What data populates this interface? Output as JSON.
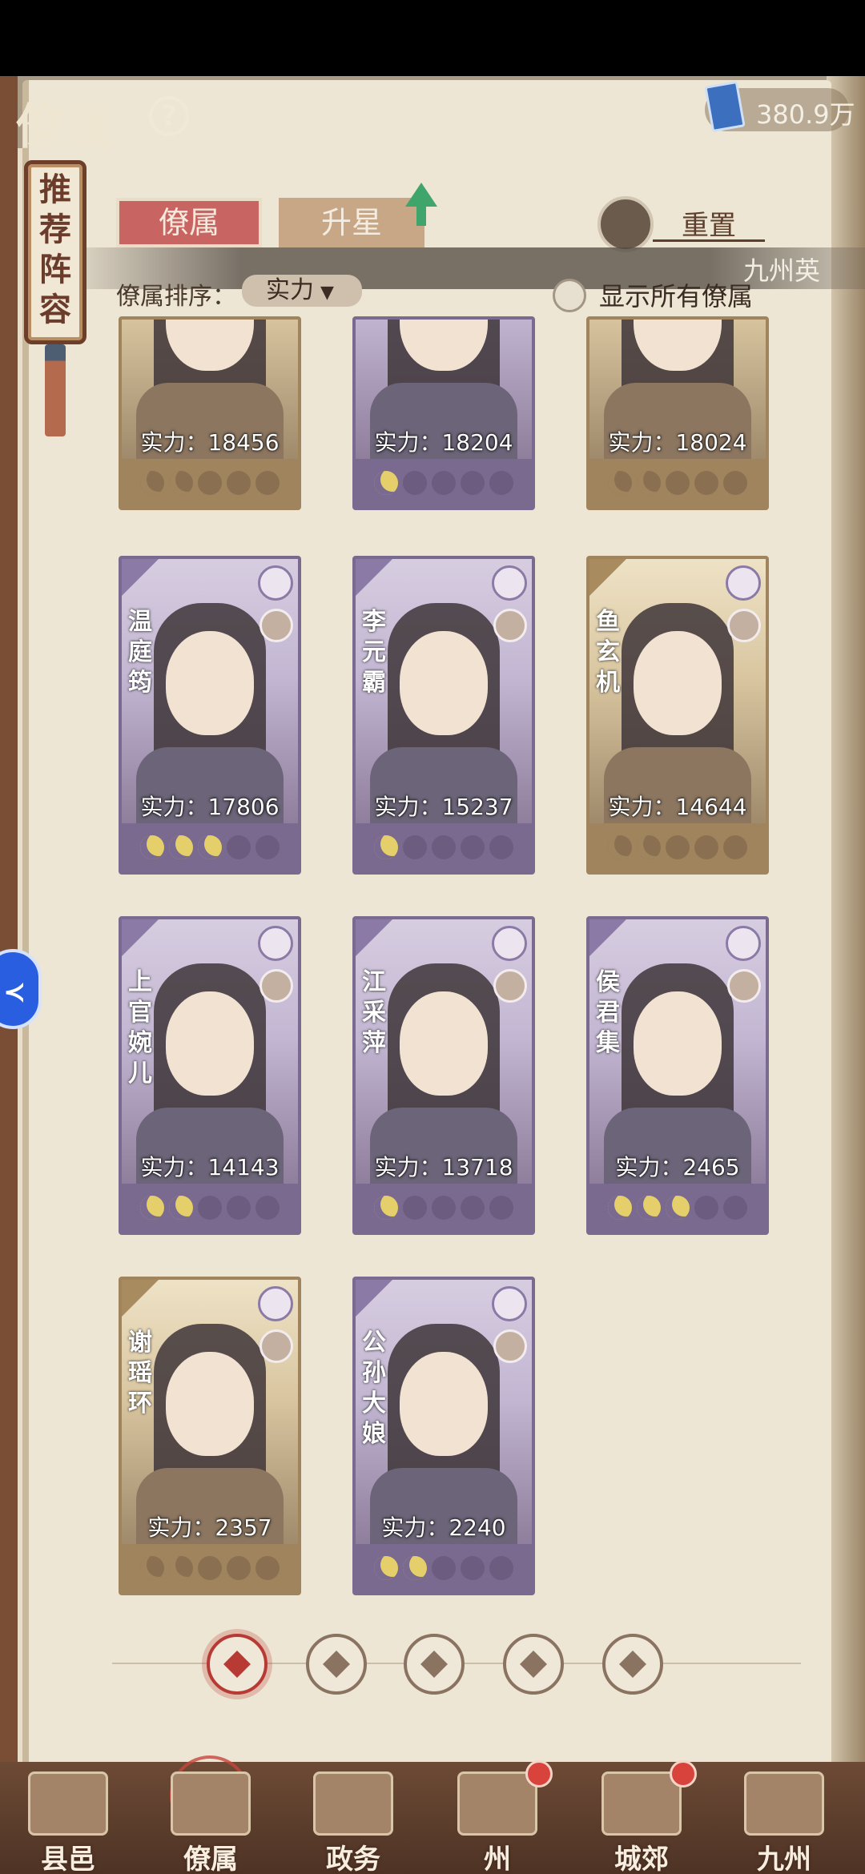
{
  "header": {
    "title": "僚属",
    "help_icon": "question-icon",
    "currency_value": "380.9万",
    "currency_icon": "book-icon"
  },
  "side_scroll": {
    "label": "推荐阵容"
  },
  "tabs": [
    {
      "label": "僚属",
      "active": true
    },
    {
      "label": "升星",
      "active": false
    }
  ],
  "reset_label": "重置",
  "banner_text": "九州英",
  "sort": {
    "label": "僚属排序：",
    "value": "实力"
  },
  "show_all_label": "显示所有僚属",
  "cards": [
    {
      "name": "",
      "power": "实力：18456",
      "stars": 2,
      "frame": "gold"
    },
    {
      "name": "",
      "power": "实力：18204",
      "stars": 1,
      "frame": "purple"
    },
    {
      "name": "",
      "power": "实力：18024",
      "stars": 2,
      "frame": "gold"
    },
    {
      "name": "温庭筠",
      "power": "实力：17806",
      "stars": 3,
      "frame": "purple"
    },
    {
      "name": "李元霸",
      "power": "实力：15237",
      "stars": 1,
      "frame": "purple"
    },
    {
      "name": "鱼玄机",
      "power": "实力：14644",
      "stars": 2,
      "frame": "gold"
    },
    {
      "name": "上官婉儿",
      "power": "实力：14143",
      "stars": 2,
      "frame": "purple"
    },
    {
      "name": "江采萍",
      "power": "实力：13718",
      "stars": 1,
      "frame": "purple"
    },
    {
      "name": "侯君集",
      "power": "实力：2465",
      "stars": 3,
      "frame": "purple"
    },
    {
      "name": "谢瑶环",
      "power": "实力：2357",
      "stars": 2,
      "frame": "gold"
    },
    {
      "name": "公孙大娘",
      "power": "实力：2240",
      "stars": 2,
      "frame": "purple"
    }
  ],
  "filters": [
    {
      "icon": "all-diamond-icon",
      "active": true
    },
    {
      "icon": "bell-icon",
      "active": false
    },
    {
      "icon": "gourd-icon",
      "active": false
    },
    {
      "icon": "fan-icon",
      "active": false
    },
    {
      "icon": "seal-icon",
      "active": false
    }
  ],
  "nav": [
    {
      "label": "县邑",
      "badge": false
    },
    {
      "label": "僚属",
      "badge": false,
      "active": true
    },
    {
      "label": "政务",
      "badge": false
    },
    {
      "label": "州",
      "badge": true
    },
    {
      "label": "城郊",
      "badge": true
    },
    {
      "label": "九州",
      "badge": false
    }
  ]
}
